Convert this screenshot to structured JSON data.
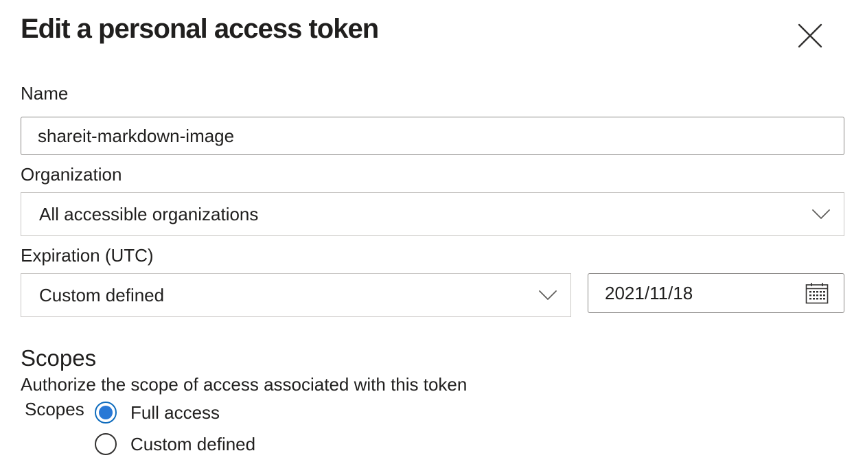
{
  "dialog": {
    "title": "Edit a personal access token"
  },
  "form": {
    "name": {
      "label": "Name",
      "value": "shareit-markdown-image"
    },
    "organization": {
      "label": "Organization",
      "selected": "All accessible organizations"
    },
    "expiration": {
      "label": "Expiration (UTC)",
      "selected": "Custom defined",
      "date": "2021/11/18"
    }
  },
  "scopes": {
    "title": "Scopes",
    "description": "Authorize the scope of access associated with this token",
    "group_label": "Scopes",
    "options": [
      {
        "label": "Full access",
        "checked": true
      },
      {
        "label": "Custom defined",
        "checked": false
      }
    ]
  },
  "colors": {
    "accent": "#2878d6",
    "border": "#8a8886",
    "text": "#201f1e"
  },
  "icons": {
    "close": "close-icon",
    "dropdown": "chevron-down-icon",
    "calendar": "calendar-icon"
  }
}
